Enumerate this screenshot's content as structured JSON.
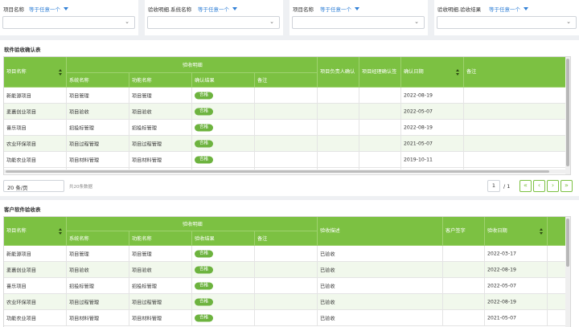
{
  "filters": [
    {
      "label": "项目名称",
      "operator": "等于任意一个",
      "value": ""
    },
    {
      "label": "验收明细.系统名称",
      "operator": "等于任意一个",
      "value": ""
    },
    {
      "label": "项目名称",
      "operator": "等于任意一个",
      "value": ""
    },
    {
      "label": "验收明细.验收结果",
      "operator": "等于任意一个",
      "value": ""
    }
  ],
  "table1": {
    "title": "软件验收确认表",
    "group_header": "验收明细",
    "headers": {
      "project": "项目名称",
      "system": "系统名称",
      "func": "功能名称",
      "result": "确认结果",
      "remark": "备注",
      "owner": "项目负责人确认",
      "manager": "项目经理确认签",
      "date": "确认日期",
      "note": "备注"
    },
    "rows": [
      {
        "project": "新能源项目",
        "system": "项目管理",
        "func": "项目管理",
        "result": "合格",
        "date": "2022-08-19"
      },
      {
        "project": "麦嘉创业项目",
        "system": "项目验收",
        "func": "项目验收",
        "result": "合格",
        "date": "2022-05-07"
      },
      {
        "project": "喜乐项目",
        "system": "招投标管理",
        "func": "招投标管理",
        "result": "合格",
        "date": "2022-08-19"
      },
      {
        "project": "农业环保项目",
        "system": "项目过程管理",
        "func": "项目过程管理",
        "result": "合格",
        "date": "2021-05-07"
      },
      {
        "project": "功能农业项目",
        "system": "项目材料管理",
        "func": "项目材料管理",
        "result": "合格",
        "date": "2019-10-11"
      }
    ]
  },
  "pagination": {
    "page_size": "20 条/页",
    "total": "共20条数据",
    "page": "1",
    "pages": "/ 1",
    "first": "«",
    "prev": "‹",
    "next": "›",
    "last": "»"
  },
  "table2": {
    "title": "客户软件验收表",
    "group_header": "验收明细",
    "headers": {
      "project": "项目名称",
      "system": "系统名称",
      "func": "功能名称",
      "result": "验收结果",
      "remark": "备注",
      "desc": "验收描述",
      "sign": "客户签字",
      "date": "验收日期"
    },
    "rows": [
      {
        "project": "新能源项目",
        "system": "项目管理",
        "func": "项目管理",
        "result": "合格",
        "desc": "已验收",
        "date": "2022-03-17"
      },
      {
        "project": "麦嘉创业项目",
        "system": "项目验收",
        "func": "项目验收",
        "result": "合格",
        "desc": "已验收",
        "date": "2022-08-19"
      },
      {
        "project": "喜乐项目",
        "system": "招投标管理",
        "func": "招投标管理",
        "result": "合格",
        "desc": "已验收",
        "date": "2022-05-07"
      },
      {
        "project": "农业环保项目",
        "system": "项目过程管理",
        "func": "项目过程管理",
        "result": "合格",
        "desc": "已验收",
        "date": "2022-08-19"
      },
      {
        "project": "功能农业项目",
        "system": "项目材料管理",
        "func": "项目材料管理",
        "result": "合格",
        "desc": "已验收",
        "date": "2021-05-07"
      }
    ]
  },
  "colors": {
    "header_green": "#7cc142",
    "badge_green": "#6db33f",
    "link_blue": "#2f7fd6"
  },
  "icons": [
    "chevron-down-icon",
    "sort-icon",
    "first-page-icon",
    "prev-page-icon",
    "next-page-icon",
    "last-page-icon"
  ]
}
